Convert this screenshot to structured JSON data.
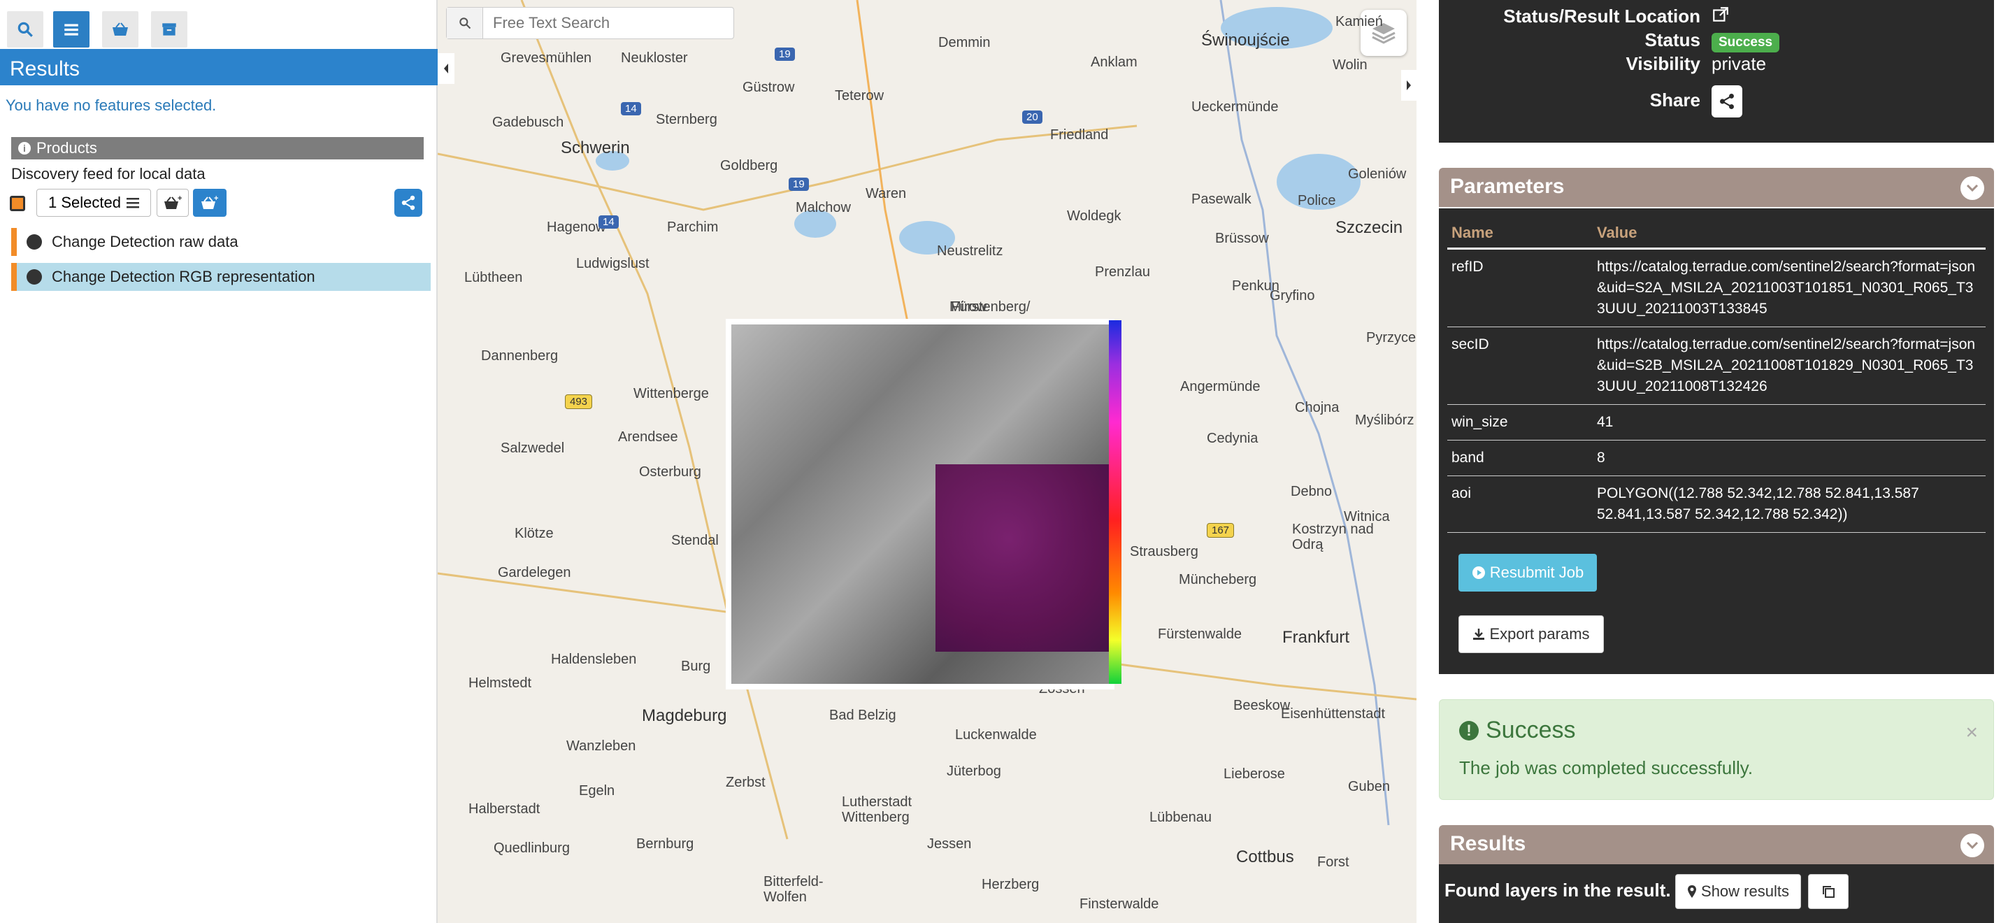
{
  "left": {
    "tabs": [
      {
        "icon": "search-icon"
      },
      {
        "icon": "list-icon"
      },
      {
        "icon": "basket-icon"
      },
      {
        "icon": "archive-icon"
      }
    ],
    "results_title": "Results",
    "no_features": "You have no features selected.",
    "products_header": "Products",
    "discovery_label": "Discovery feed for local data",
    "selected_label": "1 Selected",
    "items": [
      {
        "label": "Change Detection raw data"
      },
      {
        "label": "Change Detection RGB representation"
      }
    ],
    "accent_color": "#2c83cc",
    "marker_color": "#f28c28"
  },
  "map": {
    "search_placeholder": "Free Text Search",
    "places": [
      "Grevesmühlen",
      "Neukloster",
      "Demmin",
      "Anklam",
      "Świnoujście",
      "Kamień",
      "Wolin",
      "Gadebusch",
      "Sternberg",
      "Güstrow",
      "Teterow",
      "Schwerin",
      "Goldberg",
      "Friedland",
      "Ueckermünde",
      "Goleniów",
      "Waren",
      "Malchow",
      "Woldegk",
      "Pasewalk",
      "Police",
      "Szczecin",
      "Hagenow",
      "Parchim",
      "Brüssow",
      "Ludwigslust",
      "Neustrelitz",
      "Prenzlau",
      "Penkun",
      "Gryfino",
      "Lübtheen",
      "Mirow",
      "Fürstenberg/",
      "Pyrzyce",
      "Dannenberg",
      "Wittenberge",
      "Angermünde",
      "Chojna",
      "Myślibórz",
      "Arendsee",
      "Salzwedel",
      "Cedynia",
      "Osterburg",
      "Debno",
      "Klötze",
      "Stendal",
      "Witnica",
      "Kostrzyn nad Odrą",
      "Strausberg",
      "Gardelegen",
      "Müncheberg",
      "Fürstenwalde",
      "Frankfurt",
      "Haldensleben",
      "Burg",
      "Helmstedt",
      "Magdeburg",
      "Bad Belzig",
      "Luckenwalde",
      "Beeskow",
      "Eisenhüttenstadt",
      "Wanzleben",
      "Zerbst",
      "Jüterbog",
      "Lieberose",
      "Halberstadt",
      "Egeln",
      "Lutherstadt Wittenberg",
      "Lübbenau",
      "Guben",
      "Quedlinburg",
      "Bernburg",
      "Jessen",
      "Cottbus",
      "Forst",
      "Bitterfeld-Wolfen",
      "Herzberg",
      "Finsterwalde",
      "Zossen"
    ],
    "roads": [
      "19",
      "14",
      "20",
      "19",
      "14",
      "493",
      "167"
    ]
  },
  "right": {
    "status_location_label": "Status/Result Location",
    "status_label": "Status",
    "status_value": "Success",
    "visibility_label": "Visibility",
    "visibility_value": "private",
    "share_label": "Share",
    "parameters_title": "Parameters",
    "params_header": {
      "name": "Name",
      "value": "Value"
    },
    "params": [
      {
        "name": "refID",
        "value": "https://catalog.terradue.com/sentinel2/search?format=json&uid=S2A_MSIL2A_20211003T101851_N0301_R065_T33UUU_20211003T133845"
      },
      {
        "name": "secID",
        "value": "https://catalog.terradue.com/sentinel2/search?format=json&uid=S2B_MSIL2A_20211008T101829_N0301_R065_T33UUU_20211008T132426"
      },
      {
        "name": "win_size",
        "value": "41"
      },
      {
        "name": "band",
        "value": "8"
      },
      {
        "name": "aoi",
        "value": "POLYGON((12.788 52.342,12.788 52.841,13.587 52.841,13.587 52.342,12.788 52.342))"
      }
    ],
    "resubmit_label": "Resubmit Job",
    "export_label": "Export params",
    "success_title": "Success",
    "success_message": "The job was completed successfully.",
    "close_symbol": "×",
    "results_title": "Results",
    "found_layers": "Found layers in the result.",
    "show_results_label": "Show results",
    "success_color": "#4cae4c",
    "section_header_color": "#a49189"
  }
}
